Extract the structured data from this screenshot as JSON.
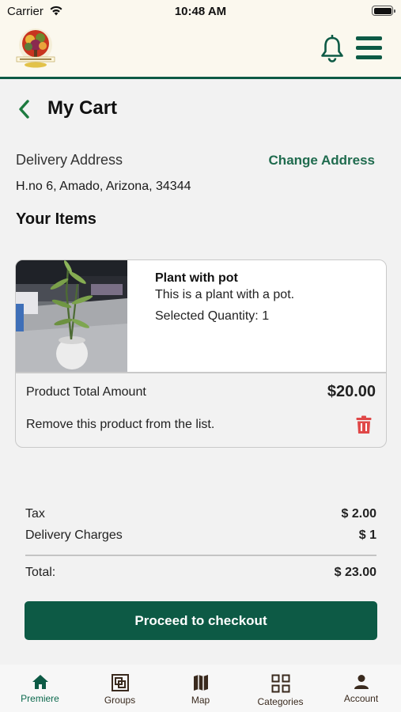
{
  "status_bar": {
    "carrier": "Carrier",
    "time": "10:48 AM"
  },
  "header": {
    "logo_icon": "brand-logo-tree",
    "notifications_icon": "bell-icon",
    "menu_icon": "hamburger-menu-icon",
    "accent_color": "#0d5a45"
  },
  "page": {
    "title": "My Cart",
    "back_icon": "chevron-left-icon"
  },
  "delivery": {
    "label": "Delivery Address",
    "change_label": "Change Address",
    "address": "H.no 6, Amado, Arizona, 34344"
  },
  "items": {
    "heading": "Your Items",
    "list": [
      {
        "name": "Plant with pot",
        "description": "This is a plant with a pot.",
        "quantity_text": "Selected Quantity: 1",
        "total_label": "Product Total Amount",
        "total_value": "$20.00",
        "remove_label": "Remove this product from the list.",
        "remove_icon": "trash-icon"
      }
    ]
  },
  "summary": {
    "tax_label": "Tax",
    "tax_value": "$ 2.00",
    "delivery_label": "Delivery Charges",
    "delivery_value": "$ 1",
    "total_label": "Total:",
    "total_value": "$ 23.00"
  },
  "checkout": {
    "label": "Proceed to checkout"
  },
  "tabs": [
    {
      "label": "Premiere",
      "icon": "home-icon",
      "active": true
    },
    {
      "label": "Groups",
      "icon": "groups-icon",
      "active": false
    },
    {
      "label": "Map",
      "icon": "map-icon",
      "active": false
    },
    {
      "label": "Categories",
      "icon": "categories-grid-icon",
      "active": false
    },
    {
      "label": "Account",
      "icon": "account-icon",
      "active": false
    }
  ]
}
